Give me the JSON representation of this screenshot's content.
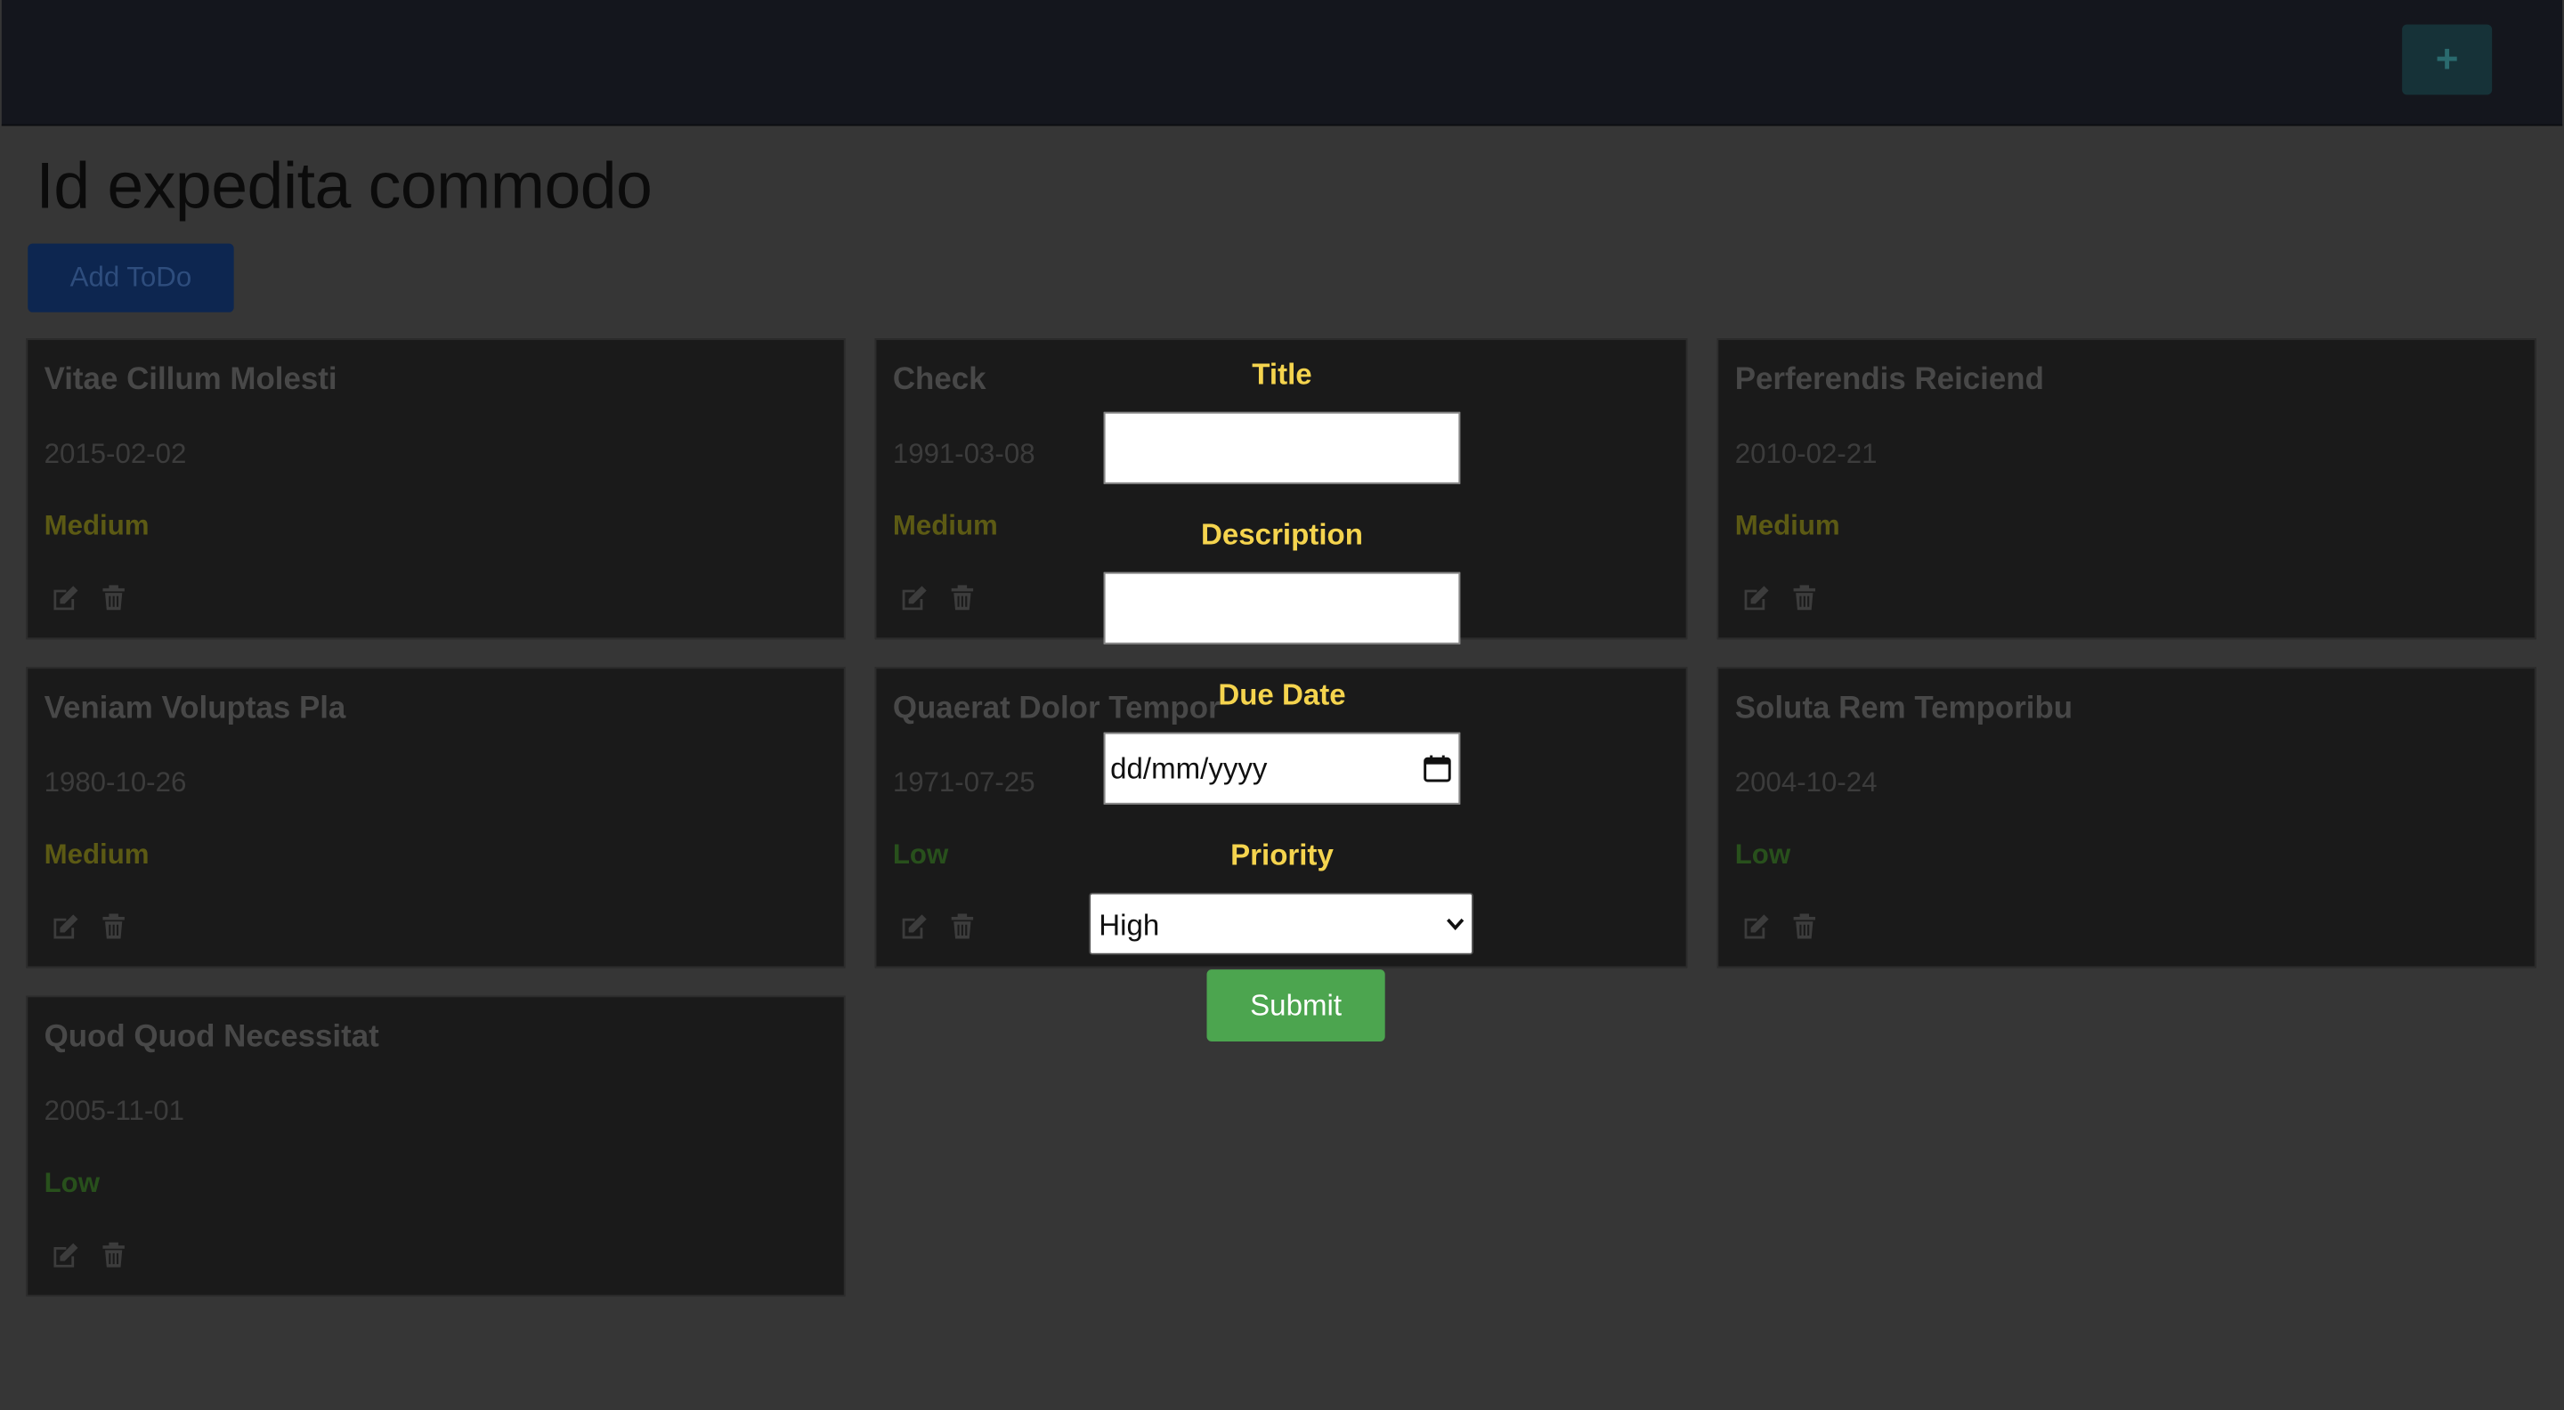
{
  "header": {
    "add_icon": "plus-icon",
    "add_label": "+"
  },
  "page": {
    "title": "Id expedita commodo",
    "add_todo_label": "Add ToDo"
  },
  "colors": {
    "background": "#363636",
    "card": "#1a1a1a",
    "label": "#f5d44e",
    "submit": "#4ca54f"
  },
  "cards": [
    {
      "title": "Vitae Cillum Molesti",
      "date": "2015-02-02",
      "priority": "Medium"
    },
    {
      "title": "Check",
      "date": "1991-03-08",
      "priority": "Medium"
    },
    {
      "title": "Perferendis Reiciend",
      "date": "2010-02-21",
      "priority": "Medium"
    },
    {
      "title": "Veniam Voluptas Pla",
      "date": "1980-10-26",
      "priority": "Medium"
    },
    {
      "title": "Quaerat Dolor Tempor",
      "date": "1971-07-25",
      "priority": "Low"
    },
    {
      "title": "Soluta Rem Temporibu",
      "date": "2004-10-24",
      "priority": "Low"
    },
    {
      "title": "Quod Quod Necessitat",
      "date": "2005-11-01",
      "priority": "Low"
    }
  ],
  "form": {
    "title_label": "Title",
    "title_value": "",
    "description_label": "Description",
    "description_value": "",
    "due_date_label": "Due Date",
    "due_date_placeholder": "dd/mm/yyyy",
    "priority_label": "Priority",
    "priority_selected": "High",
    "submit_label": "Submit"
  }
}
